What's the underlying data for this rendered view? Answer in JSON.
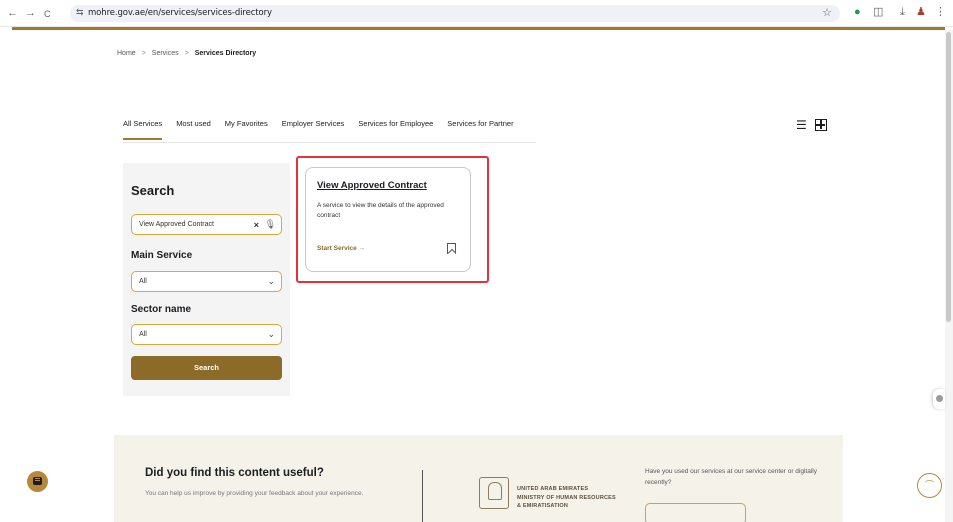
{
  "browser": {
    "url": "mohre.gov.ae/en/services/services-directory",
    "back_icon": "←",
    "forward_icon": "→",
    "reload_icon": "C"
  },
  "breadcrumb": {
    "home": "Home",
    "services": "Services",
    "current": "Services Directory",
    "separator": ">"
  },
  "tabs": [
    {
      "label": "All Services",
      "active": true
    },
    {
      "label": "Most used",
      "active": false
    },
    {
      "label": "My Favorites",
      "active": false
    },
    {
      "label": "Employer Services",
      "active": false
    },
    {
      "label": "Services for Employee",
      "active": false
    },
    {
      "label": "Services for Partner",
      "active": false
    }
  ],
  "search_panel": {
    "title": "Search",
    "search_value": "View Approved Contract",
    "main_service_label": "Main Service",
    "main_service_value": "All",
    "sector_label": "Sector name",
    "sector_value": "All",
    "search_button": "Search"
  },
  "service_card": {
    "title": "View Approved Contract",
    "description": "A service to view the details of the approved contract",
    "start_label": "Start Service →"
  },
  "feedback": {
    "title": "Did you find this content useful?",
    "subtitle": "You can help us improve by providing your feedback about your experience.",
    "ministry_lines": [
      "UNITED ARAB EMIRATES",
      "MINISTRY OF HUMAN RESOURCES",
      "& EMIRATISATION"
    ],
    "used_services_text": "Have you used our services at our service center or digitally recently?"
  },
  "colors": {
    "accent": "#a0792c",
    "button": "#8c6b28",
    "highlight": "#e0343a"
  }
}
